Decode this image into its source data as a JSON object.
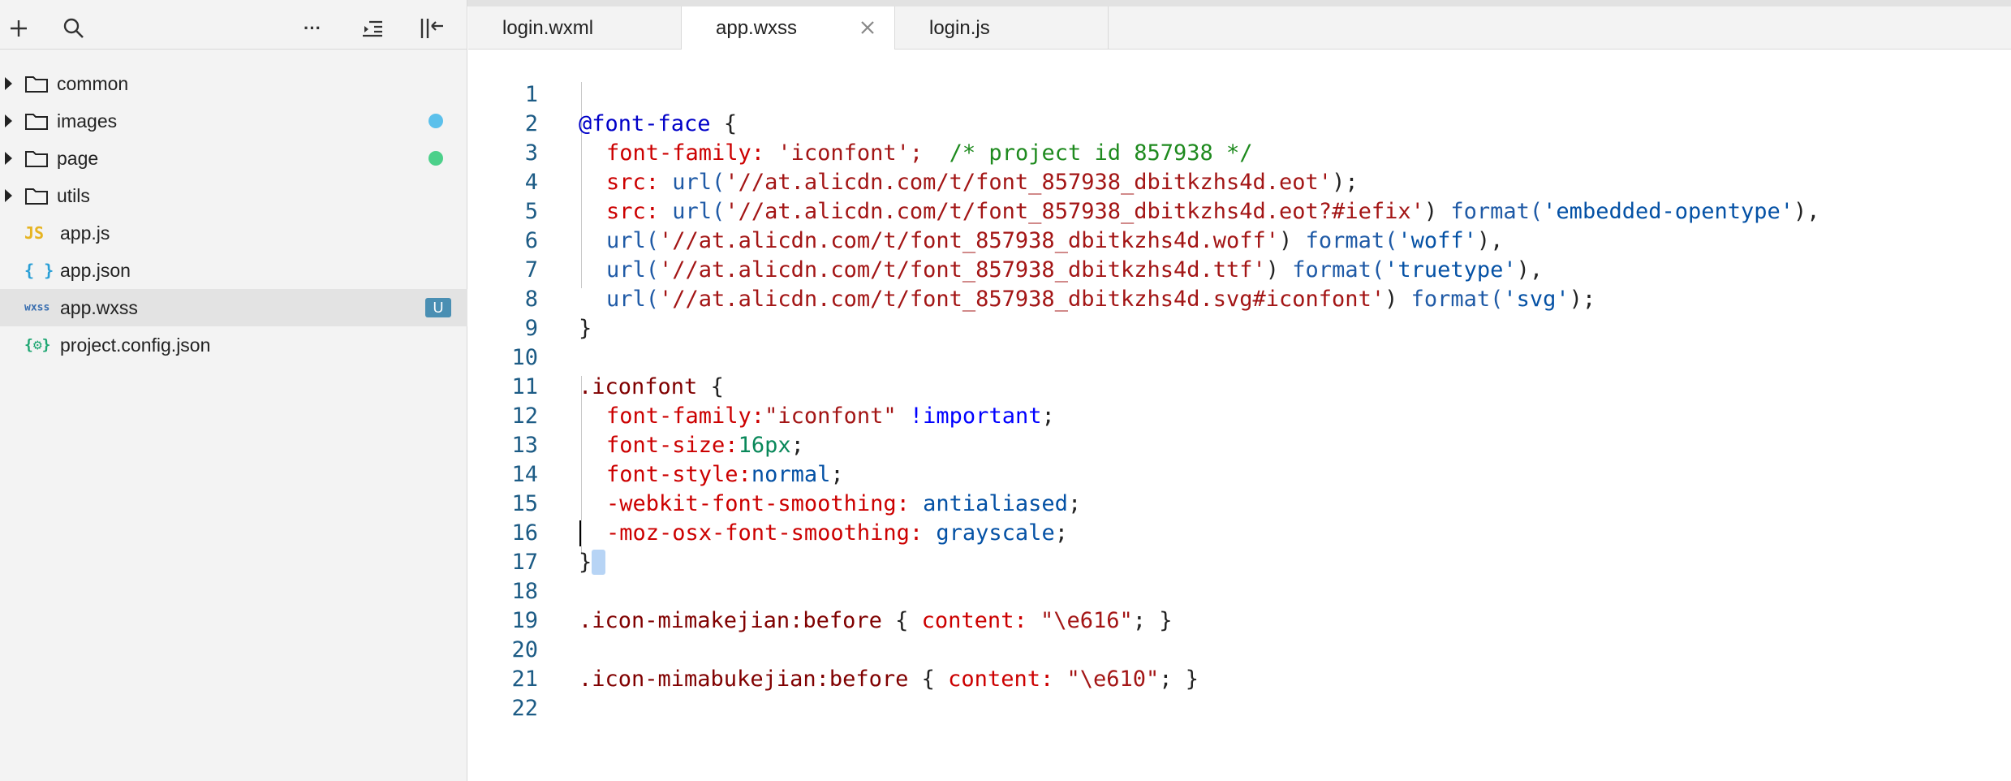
{
  "colors": {
    "sidebar_bg": "#f3f3f3",
    "selected_row": "#e3e3e3",
    "dot_blue": "#5bc0eb",
    "dot_green": "#4cd08a",
    "badge_bg": "#4a8fb3",
    "line_number": "#1c5b85"
  },
  "toolbar": {
    "icons": [
      "add-icon",
      "search-icon",
      "more-icon",
      "outdent-icon",
      "collapse-sidebar-icon"
    ],
    "more_label": "···"
  },
  "tree": [
    {
      "label": "common",
      "type": "folder"
    },
    {
      "label": "images",
      "type": "folder",
      "status": "blue-dot"
    },
    {
      "label": "page",
      "type": "folder",
      "status": "green-dot"
    },
    {
      "label": "utils",
      "type": "folder"
    },
    {
      "label": "app.js",
      "type": "js",
      "icon_text": "JS"
    },
    {
      "label": "app.json",
      "type": "json",
      "icon_text": "{ }"
    },
    {
      "label": "app.wxss",
      "type": "wxss",
      "icon_text": "wxss",
      "selected": true,
      "badge": "U"
    },
    {
      "label": "project.config.json",
      "type": "config",
      "icon_text": "{⚙}"
    }
  ],
  "tabs": [
    {
      "label": "login.wxml"
    },
    {
      "label": "app.wxss",
      "active": true
    },
    {
      "label": "login.js"
    }
  ],
  "line_numbers": [
    "1",
    "2",
    "3",
    "4",
    "5",
    "6",
    "7",
    "8",
    "9",
    "10",
    "11",
    "12",
    "13",
    "14",
    "15",
    "16",
    "17",
    "18",
    "19",
    "20",
    "21",
    "22"
  ],
  "code": {
    "l1": [
      "@font-face",
      " {"
    ],
    "l2": [
      "font-family:",
      " 'iconfont';",
      "  /* project id 857938 */"
    ],
    "l3": [
      "src:",
      " url(",
      "'//at.alicdn.com/t/font_857938_dbitkzhs4d.eot'",
      ");"
    ],
    "l4": [
      "src:",
      " url(",
      "'//at.alicdn.com/t/font_857938_dbitkzhs4d.eot?#iefix'",
      ") ",
      "format(",
      "'embedded-opentype'",
      "),"
    ],
    "l5": [
      "url(",
      "'//at.alicdn.com/t/font_857938_dbitkzhs4d.woff'",
      ") ",
      "format(",
      "'woff'",
      "),"
    ],
    "l6": [
      "url(",
      "'//at.alicdn.com/t/font_857938_dbitkzhs4d.ttf'",
      ") ",
      "format(",
      "'truetype'",
      "),"
    ],
    "l7": [
      "url(",
      "'//at.alicdn.com/t/font_857938_dbitkzhs4d.svg#iconfont'",
      ") ",
      "format(",
      "'svg'",
      ");"
    ],
    "l8": [
      "}"
    ],
    "l10": [
      ".iconfont",
      " {"
    ],
    "l11": [
      "font-family:",
      "\"iconfont\"",
      " ",
      "!important",
      ";"
    ],
    "l12": [
      "font-size:",
      "16px",
      ";"
    ],
    "l13": [
      "font-style:",
      "normal",
      ";"
    ],
    "l14": [
      "-webkit-font-smoothing:",
      " antialiased",
      ";"
    ],
    "l15": [
      "-moz-osx-font-smoothing:",
      " grayscale",
      ";"
    ],
    "l16": [
      "}"
    ],
    "l18": [
      ".icon-mimakejian:before",
      " { ",
      "content:",
      " \"\\e616\"",
      "; }"
    ],
    "l20": [
      ".icon-mimabukejian:before",
      " { ",
      "content:",
      " \"\\e610\"",
      "; }"
    ]
  }
}
